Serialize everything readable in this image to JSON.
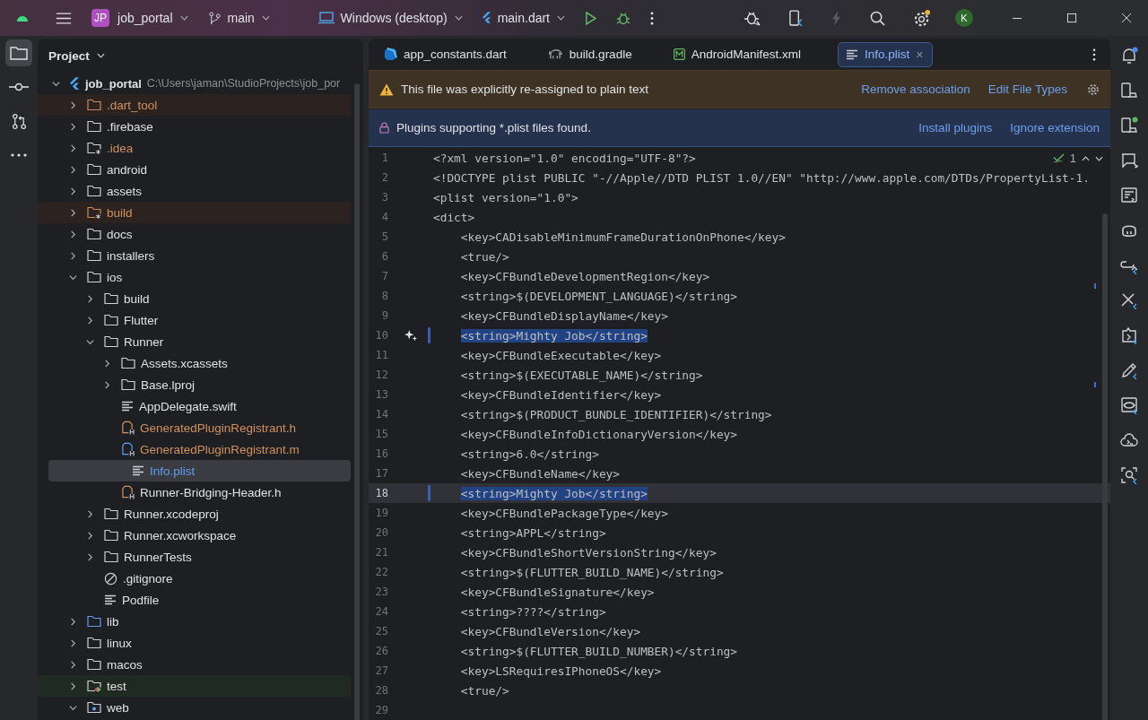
{
  "title_bar": {
    "project_badge": "JP",
    "project": "job_portal",
    "branch": "main",
    "device": "Windows (desktop)",
    "run_config": "main.dart",
    "avatar": "K"
  },
  "left_toolbar": [
    {
      "kind": "project",
      "selected": true
    },
    {
      "kind": "commit",
      "selected": false
    },
    {
      "kind": "pullrequest",
      "selected": false
    },
    {
      "kind": "more",
      "selected": false
    }
  ],
  "project_panel": {
    "title": "Project",
    "tree": [
      {
        "label": "job_portal",
        "path": "C:\\Users\\jaman\\StudioProjects\\job_por",
        "kind": "root",
        "expanded": true,
        "selected": false,
        "excluded": false,
        "color": "#dfe1e5",
        "children": [
          {
            "label": ".dart_tool",
            "kind": "folder",
            "expanded": false,
            "selected": false,
            "excluded": true,
            "color": "#d0915e"
          },
          {
            "label": ".firebase",
            "kind": "folder",
            "expanded": false,
            "selected": false,
            "excluded": false,
            "color": "#dfe1e5"
          },
          {
            "label": ".idea",
            "kind": "configfolder",
            "expanded": false,
            "selected": false,
            "excluded": false,
            "color": "#d0915e"
          },
          {
            "label": "android",
            "kind": "folder",
            "expanded": false,
            "selected": false,
            "excluded": false,
            "color": "#dfe1e5"
          },
          {
            "label": "assets",
            "kind": "folder",
            "expanded": false,
            "selected": false,
            "excluded": false,
            "color": "#dfe1e5"
          },
          {
            "label": "build",
            "kind": "configfolder",
            "expanded": false,
            "selected": false,
            "excluded": true,
            "color": "#d0915e"
          },
          {
            "label": "docs",
            "kind": "folder",
            "expanded": false,
            "selected": false,
            "excluded": false,
            "color": "#dfe1e5"
          },
          {
            "label": "installers",
            "kind": "folder",
            "expanded": false,
            "selected": false,
            "excluded": false,
            "color": "#dfe1e5"
          },
          {
            "label": "ios",
            "kind": "folder",
            "expanded": true,
            "selected": false,
            "excluded": false,
            "color": "#dfe1e5",
            "children": [
              {
                "label": "build",
                "kind": "folder",
                "expanded": false,
                "selected": false,
                "excluded": false,
                "color": "#dfe1e5"
              },
              {
                "label": "Flutter",
                "kind": "folder",
                "expanded": false,
                "selected": false,
                "excluded": false,
                "color": "#dfe1e5"
              },
              {
                "label": "Runner",
                "kind": "folder",
                "expanded": true,
                "selected": false,
                "excluded": false,
                "color": "#dfe1e5",
                "children": [
                  {
                    "label": "Assets.xcassets",
                    "kind": "folder",
                    "expanded": false,
                    "selected": false,
                    "excluded": false,
                    "color": "#dfe1e5"
                  },
                  {
                    "label": "Base.lproj",
                    "kind": "folder",
                    "expanded": false,
                    "selected": false,
                    "excluded": false,
                    "color": "#dfe1e5"
                  },
                  {
                    "label": "AppDelegate.swift",
                    "kind": "text",
                    "selected": false,
                    "excluded": false,
                    "color": "#dfe1e5"
                  },
                  {
                    "label": "GeneratedPluginRegistrant.h",
                    "kind": "header",
                    "selected": false,
                    "excluded": false,
                    "color": "#d0915e"
                  },
                  {
                    "label": "GeneratedPluginRegistrant.m",
                    "kind": "source",
                    "selected": false,
                    "excluded": false,
                    "color": "#d0915e"
                  },
                  {
                    "label": "Info.plist",
                    "kind": "text",
                    "selected": true,
                    "excluded": false,
                    "color": "#5e9cf0"
                  },
                  {
                    "label": "Runner-Bridging-Header.h",
                    "kind": "header",
                    "selected": false,
                    "excluded": false,
                    "color": "#dfe1e5"
                  }
                ]
              },
              {
                "label": "Runner.xcodeproj",
                "kind": "folder",
                "expanded": false,
                "selected": false,
                "excluded": false,
                "color": "#dfe1e5"
              },
              {
                "label": "Runner.xcworkspace",
                "kind": "folder",
                "expanded": false,
                "selected": false,
                "excluded": false,
                "color": "#dfe1e5"
              },
              {
                "label": "RunnerTests",
                "kind": "folder",
                "expanded": false,
                "selected": false,
                "excluded": false,
                "color": "#dfe1e5"
              },
              {
                "label": ".gitignore",
                "kind": "ignore",
                "selected": false,
                "excluded": false,
                "color": "#dfe1e5"
              },
              {
                "label": "Podfile",
                "kind": "text",
                "selected": false,
                "excluded": false,
                "color": "#dfe1e5"
              }
            ]
          },
          {
            "label": "lib",
            "kind": "sourcefolder",
            "expanded": false,
            "selected": false,
            "excluded": false,
            "color": "#dfe1e5"
          },
          {
            "label": "linux",
            "kind": "folder",
            "expanded": false,
            "selected": false,
            "excluded": false,
            "color": "#dfe1e5"
          },
          {
            "label": "macos",
            "kind": "folder",
            "expanded": false,
            "selected": false,
            "excluded": false,
            "color": "#dfe1e5"
          },
          {
            "label": "test",
            "kind": "testfolder",
            "expanded": false,
            "selected": false,
            "excluded": false,
            "color": "#dfe1e5"
          },
          {
            "label": "web",
            "kind": "webfolder",
            "expanded": true,
            "selected": false,
            "excluded": false,
            "color": "#dfe1e5"
          }
        ]
      }
    ]
  },
  "editor_tabs": [
    {
      "label": "app_constants.dart",
      "kind": "dart",
      "selected": false
    },
    {
      "label": "build.gradle",
      "kind": "gradle",
      "selected": false
    },
    {
      "label": "AndroidManifest.xml",
      "kind": "manifest",
      "selected": false
    },
    {
      "label": "Info.plist",
      "kind": "text",
      "selected": true,
      "close": "×"
    }
  ],
  "banners": [
    {
      "kind": "warning",
      "message": "This file was explicitly re-assigned to plain text",
      "actions": [
        "Remove association",
        "Edit File Types"
      ],
      "settings": true
    },
    {
      "kind": "plugin",
      "message": "Plugins supporting *.plist files found.",
      "actions": [
        "Install plugins",
        "Ignore extension"
      ],
      "settings": false
    }
  ],
  "inspections": {
    "count": "1"
  },
  "code_lines": [
    {
      "number": "1",
      "text": "<?xml version=\"1.0\" encoding=\"UTF-8\"?>",
      "selected": false,
      "current": false,
      "hint": false
    },
    {
      "number": "2",
      "text": "<!DOCTYPE plist PUBLIC \"-//Apple//DTD PLIST 1.0//EN\" \"http://www.apple.com/DTDs/PropertyList-1.",
      "selected": false,
      "current": false,
      "hint": false
    },
    {
      "number": "3",
      "text": "<plist version=\"1.0\">",
      "selected": false,
      "current": false,
      "hint": false
    },
    {
      "number": "4",
      "text": "<dict>",
      "selected": false,
      "current": false,
      "hint": false
    },
    {
      "number": "5",
      "text": "    <key>CADisableMinimumFrameDurationOnPhone</key>",
      "selected": false,
      "current": false,
      "hint": false
    },
    {
      "number": "6",
      "text": "    <true/>",
      "selected": false,
      "current": false,
      "hint": false
    },
    {
      "number": "7",
      "text": "    <key>CFBundleDevelopmentRegion</key>",
      "selected": false,
      "current": false,
      "hint": false
    },
    {
      "number": "8",
      "text": "    <string>$(DEVELOPMENT_LANGUAGE)</string>",
      "selected": false,
      "current": false,
      "hint": false
    },
    {
      "number": "9",
      "text": "    <key>CFBundleDisplayName</key>",
      "selected": false,
      "current": false,
      "hint": false
    },
    {
      "number": "10",
      "text": "    <string>Mighty Job</string>",
      "selected": true,
      "current": false,
      "hint": true
    },
    {
      "number": "11",
      "text": "    <key>CFBundleExecutable</key>",
      "selected": false,
      "current": false,
      "hint": false
    },
    {
      "number": "12",
      "text": "    <string>$(EXECUTABLE_NAME)</string>",
      "selected": false,
      "current": false,
      "hint": false
    },
    {
      "number": "13",
      "text": "    <key>CFBundleIdentifier</key>",
      "selected": false,
      "current": false,
      "hint": false
    },
    {
      "number": "14",
      "text": "    <string>$(PRODUCT_BUNDLE_IDENTIFIER)</string>",
      "selected": false,
      "current": false,
      "hint": false
    },
    {
      "number": "15",
      "text": "    <key>CFBundleInfoDictionaryVersion</key>",
      "selected": false,
      "current": false,
      "hint": false
    },
    {
      "number": "16",
      "text": "    <string>6.0</string>",
      "selected": false,
      "current": false,
      "hint": false
    },
    {
      "number": "17",
      "text": "    <key>CFBundleName</key>",
      "selected": false,
      "current": false,
      "hint": false
    },
    {
      "number": "18",
      "text": "    <string>Mighty Job</string>",
      "selected": true,
      "current": true,
      "hint": false
    },
    {
      "number": "19",
      "text": "    <key>CFBundlePackageType</key>",
      "selected": false,
      "current": false,
      "hint": false
    },
    {
      "number": "20",
      "text": "    <string>APPL</string>",
      "selected": false,
      "current": false,
      "hint": false
    },
    {
      "number": "21",
      "text": "    <key>CFBundleShortVersionString</key>",
      "selected": false,
      "current": false,
      "hint": false
    },
    {
      "number": "22",
      "text": "    <string>$(FLUTTER_BUILD_NAME)</string>",
      "selected": false,
      "current": false,
      "hint": false
    },
    {
      "number": "23",
      "text": "    <key>CFBundleSignature</key>",
      "selected": false,
      "current": false,
      "hint": false
    },
    {
      "number": "24",
      "text": "    <string>????</string>",
      "selected": false,
      "current": false,
      "hint": false
    },
    {
      "number": "25",
      "text": "    <key>CFBundleVersion</key>",
      "selected": false,
      "current": false,
      "hint": false
    },
    {
      "number": "26",
      "text": "    <string>$(FLUTTER_BUILD_NUMBER)</string>",
      "selected": false,
      "current": false,
      "hint": false
    },
    {
      "number": "27",
      "text": "    <key>LSRequiresIPhoneOS</key>",
      "selected": false,
      "current": false,
      "hint": false
    },
    {
      "number": "28",
      "text": "    <true/>",
      "selected": false,
      "current": false,
      "hint": false
    },
    {
      "number": "29",
      "selected": false,
      "current": false,
      "hint": false
    }
  ],
  "right_toolbar": [
    {
      "kind": "bell",
      "color": "#4a88f0"
    },
    {
      "kind": "phone"
    },
    {
      "kind": "devices",
      "color": "#5fb865"
    },
    {
      "kind": "chat"
    },
    {
      "kind": "logcat"
    },
    {
      "kind": "robot"
    },
    {
      "kind": "link"
    },
    {
      "kind": "tools"
    },
    {
      "kind": "inspector"
    },
    {
      "kind": "pencil"
    },
    {
      "kind": "preview"
    },
    {
      "kind": "cloud"
    },
    {
      "kind": "scan"
    }
  ]
}
